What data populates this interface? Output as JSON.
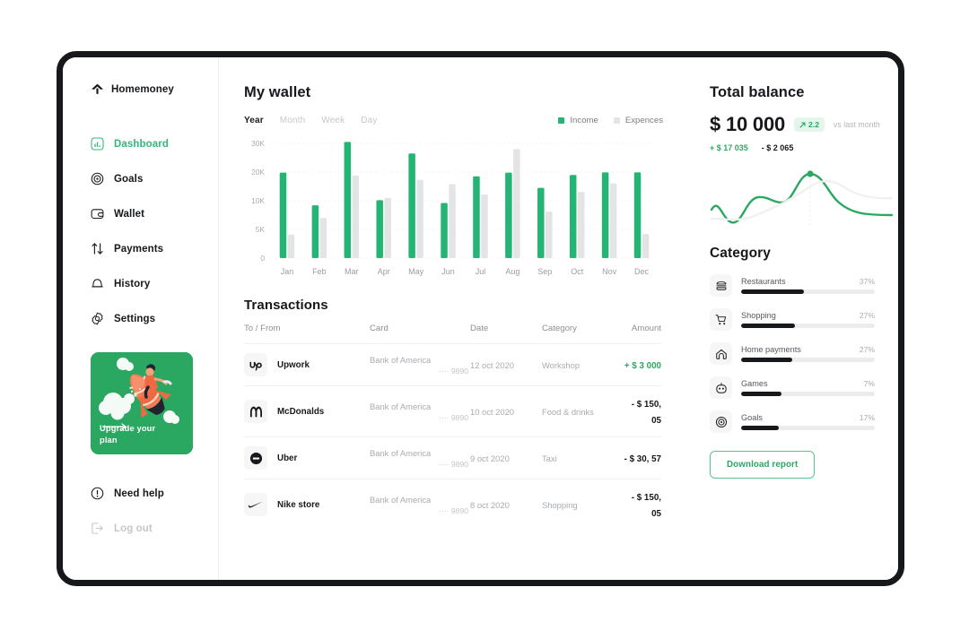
{
  "brand": {
    "name": "Homemoney",
    "icon": "home-arrow-up-icon"
  },
  "sidebar": {
    "items": [
      {
        "label": "Dashboard",
        "icon": "bar-chart-icon",
        "active": true
      },
      {
        "label": "Goals",
        "icon": "target-icon",
        "active": false
      },
      {
        "label": "Wallet",
        "icon": "wallet-icon",
        "active": false
      },
      {
        "label": "Payments",
        "icon": "arrows-up-down-icon",
        "active": false
      },
      {
        "label": "History",
        "icon": "bell-icon",
        "active": false
      },
      {
        "label": "Settings",
        "icon": "gear-icon",
        "active": false
      }
    ],
    "promo": {
      "line1": "Upgrade your",
      "line2": "plan",
      "arrow": "⟶",
      "bg": "#2aa862"
    },
    "bottom": [
      {
        "label": "Need help",
        "icon": "info-circle-icon",
        "muted": false
      },
      {
        "label": "Log out",
        "icon": "logout-icon",
        "muted": true
      }
    ]
  },
  "wallet": {
    "title": "My wallet",
    "tabs": [
      {
        "label": "Year",
        "active": true
      },
      {
        "label": "Month",
        "active": false
      },
      {
        "label": "Week",
        "active": false
      },
      {
        "label": "Day",
        "active": false
      }
    ],
    "legend": [
      {
        "label": "Income",
        "color": "#22b573"
      },
      {
        "label": "Expences",
        "color": "#e3e4e6"
      }
    ]
  },
  "chart_data": {
    "type": "bar",
    "title": "My wallet",
    "xlabel": "",
    "ylabel": "",
    "categories": [
      "Jan",
      "Feb",
      "Mar",
      "Apr",
      "May",
      "Jun",
      "Jul",
      "Aug",
      "Sep",
      "Oct",
      "Nov",
      "Dec"
    ],
    "yticks": [
      0,
      5000,
      10000,
      20000,
      30000
    ],
    "ytick_labels": [
      "0",
      "5K",
      "10K",
      "20K",
      "30K"
    ],
    "ylim": [
      0,
      32000
    ],
    "grid": true,
    "legend_position": "top-right",
    "series": [
      {
        "name": "Income",
        "color": "#22b573",
        "values": [
          19800,
          9200,
          30500,
          10200,
          26500,
          9600,
          18500,
          19800,
          14500,
          19000,
          19900,
          19900
        ]
      },
      {
        "name": "Expences",
        "color": "#e3e4e6",
        "values": [
          4100,
          7000,
          18800,
          11000,
          17300,
          15800,
          12200,
          28000,
          8100,
          13100,
          16000,
          4200
        ]
      }
    ]
  },
  "transactions": {
    "title": "Transactions",
    "columns": [
      "To / From",
      "Card",
      "Date",
      "Category",
      "Amount"
    ],
    "rows": [
      {
        "logo": "upwork-logo-icon",
        "name": "Upwork",
        "bank": "Bank of America",
        "card": "···· 9890",
        "date": "12 oct 2020",
        "category": "Workshop",
        "amount": "+ $ 3 000",
        "positive": true
      },
      {
        "logo": "mcdonalds-logo-icon",
        "name": "McDonalds",
        "bank": "Bank of America",
        "card": "···· 9890",
        "date": "10 oct 2020",
        "category": "Food & drinks",
        "amount": "- $ 150, 05",
        "positive": false
      },
      {
        "logo": "uber-logo-icon",
        "name": "Uber",
        "bank": "Bank of America",
        "card": "···· 9890",
        "date": "9 oct 2020",
        "category": "Taxi",
        "amount": "- $ 30, 57",
        "positive": false
      },
      {
        "logo": "nike-logo-icon",
        "name": "Nike store",
        "bank": "Bank of America",
        "card": "···· 9890",
        "date": "8 oct 2020",
        "category": "Shopping",
        "amount": "- $ 150, 05",
        "positive": false
      }
    ]
  },
  "balance": {
    "title": "Total balance",
    "amount": "$ 10 000",
    "badge": "2.2",
    "badge_icon": "arrow-up-right-icon",
    "vs_label": "vs last month",
    "income_delta": "+ $ 17 035",
    "expense_delta": "- $ 2 065",
    "accent": "#2aa862"
  },
  "category": {
    "title": "Category",
    "items": [
      {
        "name": "Restaurants",
        "pct": "37%",
        "fill": 47,
        "icon": "burger-icon"
      },
      {
        "name": "Shopping",
        "pct": "27%",
        "fill": 40,
        "icon": "shopping-cart-icon"
      },
      {
        "name": "Home payments",
        "pct": "27%",
        "fill": 38,
        "icon": "house-icon"
      },
      {
        "name": "Games",
        "pct": "7%",
        "fill": 30,
        "icon": "game-robot-icon"
      },
      {
        "name": "Goals",
        "pct": "17%",
        "fill": 28,
        "icon": "target-icon"
      }
    ]
  },
  "download_button": {
    "label": "Download report"
  }
}
